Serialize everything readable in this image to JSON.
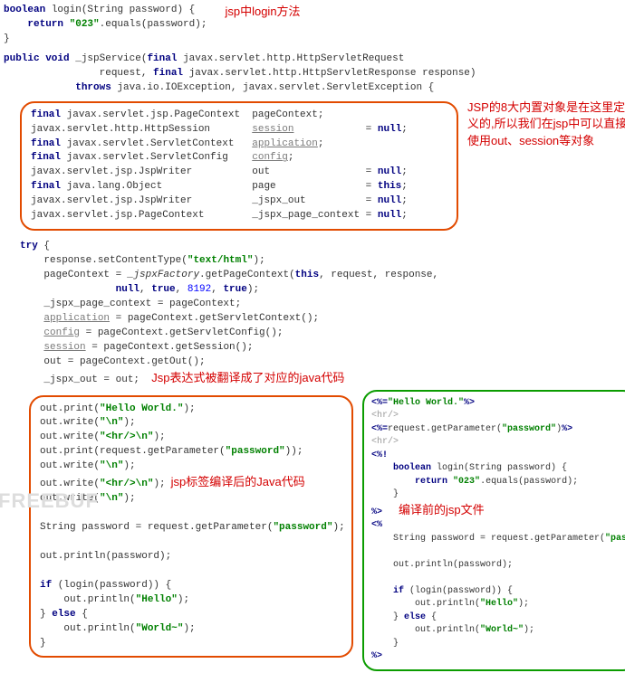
{
  "notes": {
    "login_method": "jsp中login方法",
    "builtins": "JSP的8大内置对象是在这里定义的,所以我们在jsp中可以直接使用out、session等对象",
    "expr_translated": "Jsp表达式被翻译成了对应的java代码",
    "compiled_java": "jsp标签编译后的Java代码",
    "original_jsp": "编译前的jsp文件"
  },
  "code": {
    "login": "boolean login(String password) {\n    return \"023\".equals(password);\n}",
    "jspService_sig": "public void _jspService(final javax.servlet.http.HttpServletRequest\n                request, final javax.servlet.http.HttpServletResponse response)\n            throws java.io.IOException, javax.servlet.ServletException {",
    "decls": "final javax.servlet.jsp.PageContext  pageContext;\njavax.servlet.http.HttpSession       session            = null;\nfinal javax.servlet.ServletContext   application;\nfinal javax.servlet.ServletConfig    config;\njavax.servlet.jsp.JspWriter          out                = null;\nfinal java.lang.Object               page               = this;\njavax.servlet.jsp.JspWriter          _jspx_out          = null;\njavax.servlet.jsp.PageContext        _jspx_page_context = null;",
    "try_block": "try {\n    response.setContentType(\"text/html\");\n    pageContext = _jspxFactory.getPageContext(this, request, response,\n                null, true, 8192, true);\n    _jspx_page_context = pageContext;\n    application = pageContext.getServletContext();\n    config = pageContext.getServletConfig();\n    session = pageContext.getSession();\n    out = pageContext.getOut();\n    _jspx_out = out;",
    "left_box": "out.print(\"Hello World.\");\nout.write(\"\\n\");\nout.write(\"<hr/>\\n\");\nout.print(request.getParameter(\"password\"));\nout.write(\"\\n\");\nout.write(\"<hr/>\\n\");\nout.write(\"\\n\");\n\nString password = request.getParameter(\"password\");\n\nout.println(password);\n\nif (login(password)) {\n    out.println(\"Hello\");\n} else {\n    out.println(\"World~\");\n}",
    "right_box": "<%=\"Hello World.\"%>\n<hr/>\n<%=request.getParameter(\"password\")%>\n<hr/>\n<%!\n    boolean login(String password) {\n        return \"023\".equals(password);\n    }\n%>\n<%\n    String password = request.getParameter(\"password\");\n\n    out.println(password);\n\n    if (login(password)) {\n        out.println(\"Hello\");\n    } else {\n        out.println(\"World~\");\n    }\n%>"
  },
  "watermark": "FREEBUF"
}
